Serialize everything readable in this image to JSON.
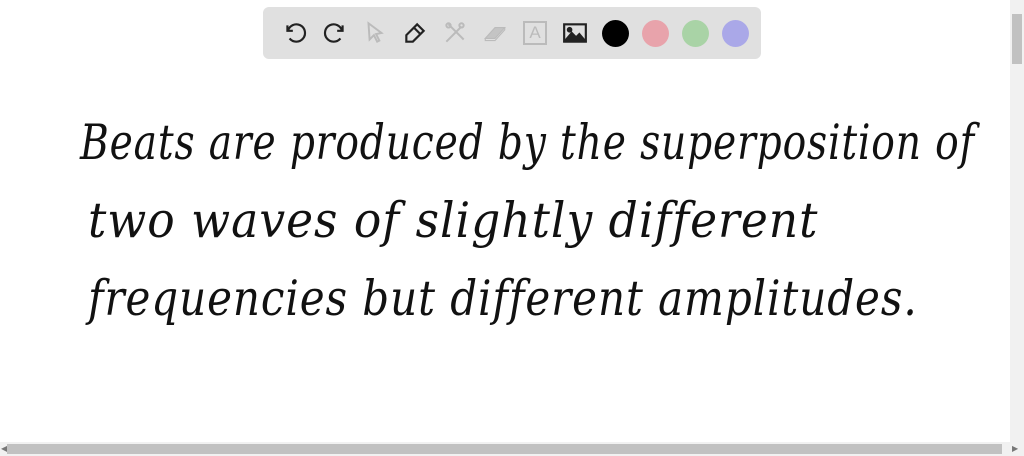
{
  "toolbar": {
    "tools": [
      {
        "name": "undo-icon",
        "enabled": true
      },
      {
        "name": "redo-icon",
        "enabled": true
      },
      {
        "name": "select-pointer-icon",
        "enabled": false
      },
      {
        "name": "pen-icon",
        "enabled": true
      },
      {
        "name": "tools-icon",
        "enabled": false
      },
      {
        "name": "eraser-icon",
        "enabled": false
      },
      {
        "name": "text-tool-icon",
        "enabled": false
      },
      {
        "name": "image-icon",
        "enabled": true
      }
    ],
    "text_tool_glyph": "A",
    "colors": [
      "#000000",
      "#e8a3ab",
      "#a9d3a6",
      "#aaa8e8"
    ]
  },
  "canvas": {
    "lines": [
      "Beats are produced by the superposition of",
      "two waves of slightly different",
      "frequencies but different amplitudes."
    ]
  }
}
